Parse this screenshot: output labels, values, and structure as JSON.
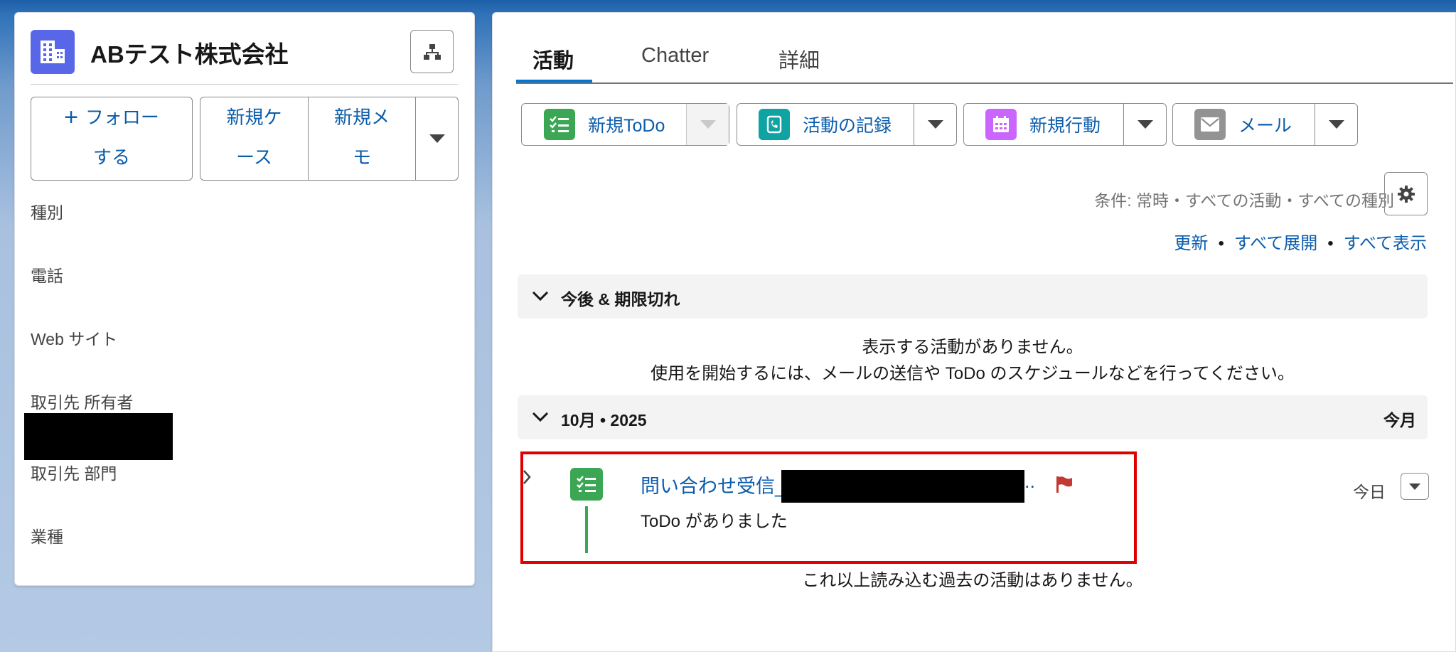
{
  "account": {
    "name": "ABテスト株式会社",
    "buttons": {
      "follow": [
        "フォロー",
        "する"
      ],
      "new_case": [
        "新規ケ",
        "ース"
      ],
      "new_memo": [
        "新規メ",
        "モ"
      ]
    },
    "fields": [
      {
        "label": "種別"
      },
      {
        "label": "電話"
      },
      {
        "label": "Web サイト"
      },
      {
        "label": "取引先 所有者"
      },
      {
        "label": "取引先 部門"
      },
      {
        "label": "業種"
      }
    ]
  },
  "tabs": {
    "activity": "活動",
    "chatter": "Chatter",
    "details": "詳細"
  },
  "publisher": {
    "new_todo": "新規ToDo",
    "log_activity": "活動の記録",
    "new_event": "新規行動",
    "email": "メール",
    "colors": {
      "todo": "#3ba755",
      "log": "#0fa3a3",
      "event": "#cb65ff",
      "email": "#939393"
    }
  },
  "filter": {
    "text": "条件: 常時・すべての活動・すべての種別"
  },
  "links": {
    "refresh": "更新",
    "expand_all": "すべて展開",
    "view_all": "すべて表示",
    "separator": "•"
  },
  "upcoming": {
    "title": "今後 & 期限切れ",
    "empty_line1": "表示する活動がありません。",
    "empty_line2": "使用を開始するには、メールの送信や ToDo のスケジュールなどを行ってください。"
  },
  "month_section": {
    "title": "10月 • 2025",
    "right": "今月"
  },
  "task": {
    "subject": "問い合わせ受信_/",
    "ellipsis": "..",
    "subtitle": "ToDo がありました",
    "date": "今日"
  },
  "no_more": "これ以上読み込む過去の活動はありません。"
}
